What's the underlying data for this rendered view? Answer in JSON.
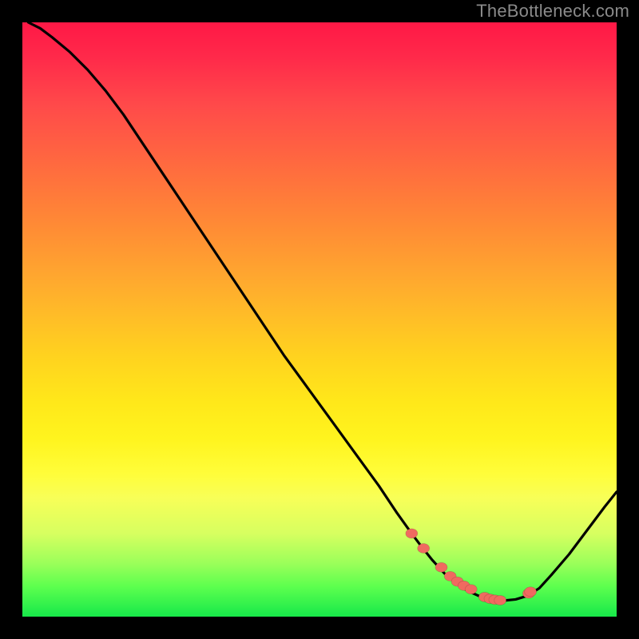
{
  "watermark": "TheBottleneck.com",
  "colors": {
    "frame_bg": "#000000",
    "curve": "#000000",
    "marker_fill": "#f06a60",
    "gradient_top": "#ff1846",
    "gradient_mid": "#ffd21f",
    "gradient_bottom": "#17e84a"
  },
  "chart_data": {
    "type": "line",
    "title": "",
    "xlabel": "",
    "ylabel": "",
    "xlim": [
      0,
      100
    ],
    "ylim": [
      0,
      100
    ],
    "grid": false,
    "legend": false,
    "note": "x and y are normalized to percent of plot area; y=100 is top. The curve descends from upper-left, bottoms out around x≈72–82, then rises toward the right edge.",
    "series": [
      {
        "name": "bottleneck-curve",
        "x": [
          1,
          3,
          5,
          8,
          11,
          14,
          17,
          20,
          24,
          28,
          32,
          36,
          40,
          44,
          48,
          52,
          56,
          60,
          63,
          65.5,
          67,
          69,
          71,
          73,
          75,
          77,
          79,
          81,
          83,
          85,
          87,
          89,
          92,
          95,
          98,
          100
        ],
        "y": [
          100,
          99,
          97.5,
          95,
          92,
          88.5,
          84.5,
          80,
          74,
          68,
          62,
          56,
          50,
          44,
          38.5,
          33,
          27.5,
          22,
          17.5,
          14,
          12,
          9.5,
          7.3,
          5.6,
          4.3,
          3.4,
          2.9,
          2.7,
          2.9,
          3.5,
          4.8,
          7,
          10.5,
          14.5,
          18.5,
          21
        ]
      }
    ],
    "markers": {
      "name": "highlighted-points",
      "description": "salmon beads along the valley of the curve",
      "x": [
        65.5,
        67.5,
        70.5,
        72,
        73.2,
        74.3,
        75.5,
        77.8,
        78.7,
        79.5,
        80.4,
        85.2,
        85.5
      ],
      "y": [
        14.0,
        11.5,
        8.3,
        6.8,
        5.9,
        5.2,
        4.6,
        3.3,
        3.0,
        2.85,
        2.75,
        3.9,
        4.2
      ]
    }
  }
}
